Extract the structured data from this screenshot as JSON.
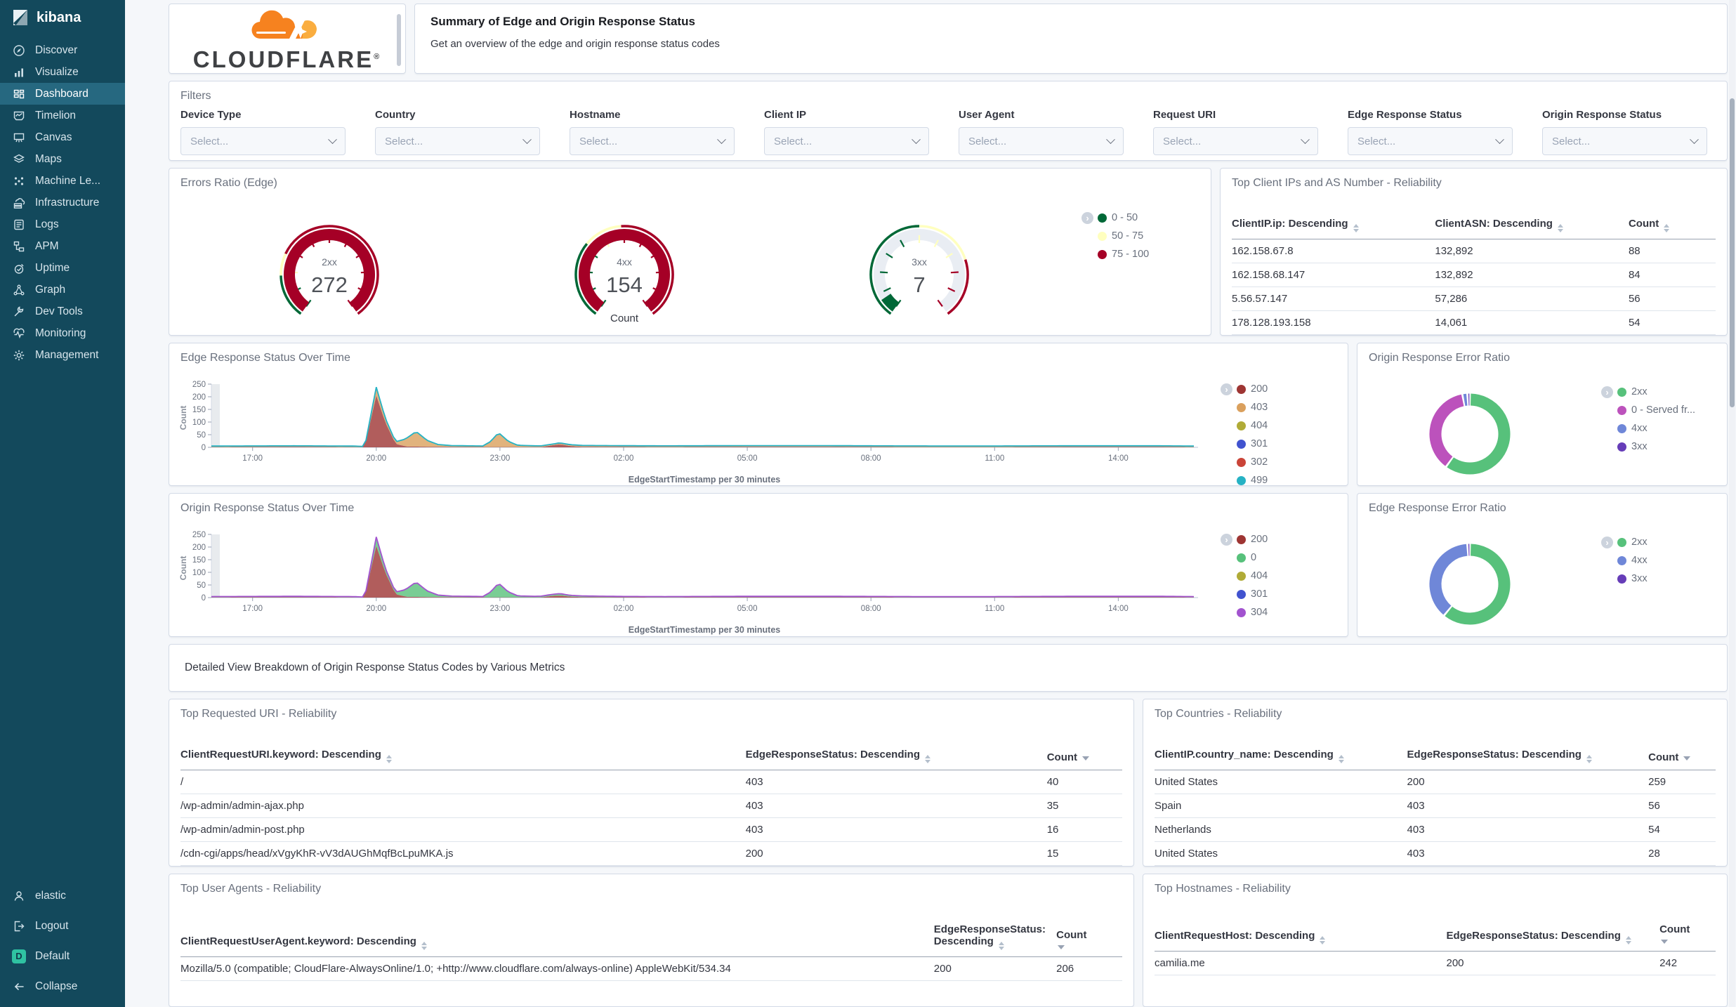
{
  "sidebar": {
    "brand": "kibana",
    "items": [
      {
        "label": "Discover",
        "icon": "discover"
      },
      {
        "label": "Visualize",
        "icon": "visualize"
      },
      {
        "label": "Dashboard",
        "icon": "dashboard",
        "selected": true
      },
      {
        "label": "Timelion",
        "icon": "timelion"
      },
      {
        "label": "Canvas",
        "icon": "canvas"
      },
      {
        "label": "Maps",
        "icon": "maps"
      },
      {
        "label": "Machine Le...",
        "icon": "ml"
      },
      {
        "label": "Infrastructure",
        "icon": "infrastructure"
      },
      {
        "label": "Logs",
        "icon": "logs"
      },
      {
        "label": "APM",
        "icon": "apm"
      },
      {
        "label": "Uptime",
        "icon": "uptime"
      },
      {
        "label": "Graph",
        "icon": "graph"
      },
      {
        "label": "Dev Tools",
        "icon": "devtools"
      },
      {
        "label": "Monitoring",
        "icon": "monitoring"
      },
      {
        "label": "Management",
        "icon": "management"
      }
    ],
    "bottom_items": [
      {
        "label": "elastic",
        "icon": "user"
      },
      {
        "label": "Logout",
        "icon": "logout"
      },
      {
        "label": "Default",
        "icon": "space-default",
        "badge": "D"
      },
      {
        "label": "Collapse",
        "icon": "collapse"
      }
    ]
  },
  "header": {
    "logo_text": "CLOUDFLARE",
    "title": "Summary of Edge and Origin Response Status",
    "subtitle": "Get an overview of the edge and origin response status codes"
  },
  "filters": {
    "title": "Filters",
    "placeholder": "Select...",
    "fields": [
      "Device Type",
      "Country",
      "Hostname",
      "Client IP",
      "User Agent",
      "Request URI",
      "Edge Response Status",
      "Origin Response Status"
    ]
  },
  "gauges_panel": {
    "title": "Errors Ratio (Edge)",
    "caption": "Count",
    "type": "gauge",
    "track_color": "#e9edf3",
    "legend": [
      {
        "label": "0 - 50",
        "color": "#006837"
      },
      {
        "label": "50 - 75",
        "color": "#ffffbf"
      },
      {
        "label": "75 - 100",
        "color": "#a50026"
      }
    ],
    "gauges": [
      {
        "label": "2xx",
        "value": 272
      },
      {
        "label": "4xx",
        "value": 154
      },
      {
        "label": "3xx",
        "value": 7
      }
    ]
  },
  "client_ips": {
    "title": "Top Client IPs and AS Number - Reliability",
    "columns": [
      {
        "label": "ClientIP.ip: Descending",
        "sort": "both"
      },
      {
        "label": "ClientASN: Descending",
        "sort": "both"
      },
      {
        "label": "Count",
        "sort": "both"
      }
    ],
    "rows": [
      [
        "162.158.67.8",
        "132,892",
        "88"
      ],
      [
        "162.158.68.147",
        "132,892",
        "84"
      ],
      [
        "5.56.57.147",
        "57,286",
        "56"
      ],
      [
        "178.128.193.158",
        "14,061",
        "54"
      ]
    ]
  },
  "edge_time": {
    "title": "Edge Response Status Over Time",
    "type": "area",
    "ylabel": "Count",
    "xlabel": "EdgeStartTimestamp per 30 minutes",
    "ymax": 250,
    "yticks": [
      0,
      50,
      100,
      150,
      200,
      250
    ],
    "xticks": [
      "17:00",
      "20:00",
      "23:00",
      "02:00",
      "05:00",
      "08:00",
      "11:00",
      "14:00"
    ],
    "xtick_minutes": [
      60,
      240,
      420,
      600,
      780,
      960,
      1140,
      1320
    ],
    "total_line_color": "#26b2c4",
    "series": [
      {
        "name": "200",
        "color": "#9e3533",
        "points": [
          [
            0,
            1
          ],
          [
            120,
            2
          ],
          [
            205,
            1
          ],
          [
            223,
            0
          ],
          [
            240,
            205
          ],
          [
            253,
            100
          ],
          [
            268,
            14
          ],
          [
            284,
            3
          ],
          [
            330,
            2
          ],
          [
            420,
            1
          ],
          [
            480,
            1
          ],
          [
            494,
            7
          ],
          [
            507,
            12
          ],
          [
            522,
            5
          ],
          [
            540,
            2
          ],
          [
            660,
            1
          ],
          [
            780,
            2
          ],
          [
            900,
            2
          ],
          [
            1020,
            1
          ],
          [
            1140,
            1
          ],
          [
            1260,
            2
          ],
          [
            1380,
            2
          ],
          [
            1430,
            1
          ]
        ]
      },
      {
        "name": "403",
        "color": "#daa05d",
        "points": [
          [
            0,
            1
          ],
          [
            150,
            1
          ],
          [
            210,
            1
          ],
          [
            225,
            0
          ],
          [
            240,
            30
          ],
          [
            254,
            12
          ],
          [
            268,
            5
          ],
          [
            280,
            22
          ],
          [
            298,
            57
          ],
          [
            314,
            22
          ],
          [
            330,
            6
          ],
          [
            350,
            2
          ],
          [
            395,
            1
          ],
          [
            406,
            18
          ],
          [
            418,
            54
          ],
          [
            432,
            20
          ],
          [
            446,
            4
          ],
          [
            470,
            2
          ],
          [
            600,
            1
          ],
          [
            900,
            1
          ],
          [
            1200,
            1
          ],
          [
            1430,
            1
          ]
        ]
      },
      {
        "name": "404",
        "color": "#b0ab37",
        "points": [
          [
            0,
            1
          ],
          [
            1430,
            1
          ]
        ]
      },
      {
        "name": "301",
        "color": "#4153cf",
        "points": [
          [
            0,
            0
          ],
          [
            1430,
            0
          ]
        ]
      },
      {
        "name": "302",
        "color": "#ca4438",
        "points": [
          [
            0,
            1
          ],
          [
            500,
            1
          ],
          [
            505,
            2
          ],
          [
            1430,
            1
          ]
        ]
      },
      {
        "name": "499",
        "color": "#26b2c4",
        "points": [
          [
            0,
            1
          ],
          [
            1430,
            1
          ]
        ]
      }
    ]
  },
  "origin_ratio": {
    "title": "Origin Response Error Ratio",
    "type": "pie",
    "slices": [
      {
        "label": "2xx",
        "value": 60,
        "color": "#57c17b"
      },
      {
        "label": "0 - Served fr...",
        "value": 37,
        "color": "#bc52bc"
      },
      {
        "label": "4xx",
        "value": 2,
        "color": "#6f87d8"
      },
      {
        "label": "3xx",
        "value": 1,
        "color": "#663db8"
      }
    ]
  },
  "origin_time": {
    "title": "Origin Response Status Over Time",
    "type": "area",
    "ylabel": "Count",
    "xlabel": "EdgeStartTimestamp per 30 minutes",
    "ymax": 250,
    "yticks": [
      0,
      50,
      100,
      150,
      200,
      250
    ],
    "xticks": [
      "17:00",
      "20:00",
      "23:00",
      "02:00",
      "05:00",
      "08:00",
      "11:00",
      "14:00"
    ],
    "xtick_minutes": [
      60,
      240,
      420,
      600,
      780,
      960,
      1140,
      1320
    ],
    "total_line_color": "#a253cf",
    "series": [
      {
        "name": "200",
        "color": "#9e3533",
        "points": [
          [
            0,
            1
          ],
          [
            120,
            2
          ],
          [
            205,
            1
          ],
          [
            223,
            0
          ],
          [
            240,
            205
          ],
          [
            253,
            100
          ],
          [
            268,
            14
          ],
          [
            284,
            3
          ],
          [
            330,
            2
          ],
          [
            420,
            1
          ],
          [
            480,
            1
          ],
          [
            494,
            6
          ],
          [
            507,
            8
          ],
          [
            522,
            4
          ],
          [
            540,
            2
          ],
          [
            660,
            1
          ],
          [
            780,
            2
          ],
          [
            900,
            2
          ],
          [
            1020,
            1
          ],
          [
            1140,
            1
          ],
          [
            1260,
            2
          ],
          [
            1380,
            2
          ],
          [
            1430,
            1
          ]
        ]
      },
      {
        "name": "0",
        "color": "#57c17b",
        "points": [
          [
            0,
            1
          ],
          [
            150,
            1
          ],
          [
            210,
            1
          ],
          [
            225,
            0
          ],
          [
            240,
            33
          ],
          [
            254,
            14
          ],
          [
            268,
            6
          ],
          [
            280,
            22
          ],
          [
            298,
            57
          ],
          [
            314,
            22
          ],
          [
            330,
            6
          ],
          [
            350,
            2
          ],
          [
            395,
            1
          ],
          [
            406,
            18
          ],
          [
            418,
            54
          ],
          [
            432,
            20
          ],
          [
            446,
            4
          ],
          [
            470,
            2
          ],
          [
            494,
            4
          ],
          [
            507,
            6
          ],
          [
            522,
            3
          ],
          [
            600,
            1
          ],
          [
            900,
            1
          ],
          [
            1200,
            1
          ],
          [
            1430,
            1
          ]
        ]
      },
      {
        "name": "404",
        "color": "#b0ab37",
        "points": [
          [
            0,
            1
          ],
          [
            1430,
            1
          ]
        ]
      },
      {
        "name": "301",
        "color": "#4153cf",
        "points": [
          [
            0,
            0
          ],
          [
            1430,
            0
          ]
        ]
      },
      {
        "name": "304",
        "color": "#a253cf",
        "points": [
          [
            0,
            1
          ],
          [
            1430,
            1
          ]
        ]
      }
    ]
  },
  "edge_ratio": {
    "title": "Edge Response Error Ratio",
    "type": "pie",
    "slices": [
      {
        "label": "2xx",
        "value": 61,
        "color": "#57c17b"
      },
      {
        "label": "4xx",
        "value": 38,
        "color": "#6f87d8"
      },
      {
        "label": "3xx",
        "value": 1,
        "color": "#663db8"
      }
    ]
  },
  "markdown_note": "Detailed View Breakdown of Origin Response Status Codes by Various Metrics",
  "top_uri": {
    "title": "Top Requested URI - Reliability",
    "columns": [
      {
        "label": "ClientRequestURI.keyword: Descending",
        "sort": "both"
      },
      {
        "label": "EdgeResponseStatus: Descending",
        "sort": "both"
      },
      {
        "label": "Count",
        "sort": "desc"
      }
    ],
    "rows": [
      [
        "/",
        "403",
        "40"
      ],
      [
        "/wp-admin/admin-ajax.php",
        "403",
        "35"
      ],
      [
        "/wp-admin/admin-post.php",
        "403",
        "16"
      ],
      [
        "/cdn-cgi/apps/head/xVgyKhR-vV3dAUGhMqfBcLpuMKA.js",
        "200",
        "15"
      ]
    ]
  },
  "top_countries": {
    "title": "Top Countries - Reliability",
    "columns": [
      {
        "label": "ClientIP.country_name: Descending",
        "sort": "both"
      },
      {
        "label": "EdgeResponseStatus: Descending",
        "sort": "both"
      },
      {
        "label": "Count",
        "sort": "desc"
      }
    ],
    "rows": [
      [
        "United States",
        "200",
        "259"
      ],
      [
        "Spain",
        "403",
        "56"
      ],
      [
        "Netherlands",
        "403",
        "54"
      ],
      [
        "United States",
        "403",
        "28"
      ]
    ]
  },
  "top_user_agents": {
    "title": "Top User Agents - Reliability",
    "columns": [
      {
        "label": "ClientRequestUserAgent.keyword: Descending",
        "sort": "both"
      },
      {
        "label": "EdgeResponseStatus: Descending",
        "sort": "desc2"
      },
      {
        "label": "Count",
        "sort": "desc"
      }
    ],
    "rows": [
      [
        "Mozilla/5.0 (compatible; CloudFlare-AlwaysOnline/1.0; +http://www.cloudflare.com/always-online) AppleWebKit/534.34",
        "200",
        "206"
      ]
    ]
  },
  "top_hostnames": {
    "title": "Top Hostnames - Reliability",
    "columns": [
      {
        "label": "ClientRequestHost: Descending",
        "sort": "both"
      },
      {
        "label": "EdgeResponseStatus: Descending",
        "sort": "desc2"
      },
      {
        "label": "Count",
        "sort": "desc"
      }
    ],
    "rows": [
      [
        "camilia.me",
        "200",
        "242"
      ]
    ]
  }
}
